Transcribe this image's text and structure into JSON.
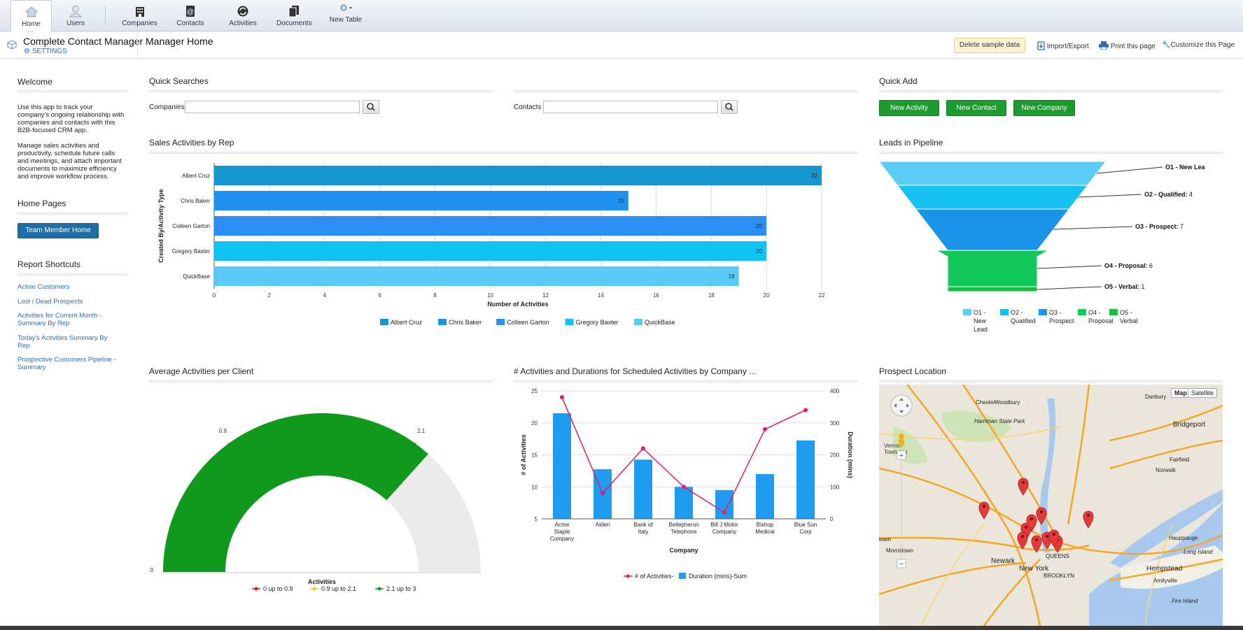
{
  "toolbar": {
    "items": [
      {
        "label": "Home",
        "icon": "home-icon"
      },
      {
        "label": "Users",
        "icon": "user-icon"
      },
      {
        "label": "Companies",
        "icon": "building-icon"
      },
      {
        "label": "Contacts",
        "icon": "contact-card-icon"
      },
      {
        "label": "Activities",
        "icon": "activities-icon"
      },
      {
        "label": "Documents",
        "icon": "documents-icon"
      },
      {
        "label": "New Table",
        "icon": "gear-icon"
      }
    ]
  },
  "header": {
    "app_name": "Complete Contact Manager",
    "settings_label": "SETTINGS",
    "page_name": "Manager Home",
    "delete_label": "Delete sample data",
    "import_label": "Import/Export",
    "print_label": "Print this page",
    "customize_label": "Customize this Page"
  },
  "sidebar": {
    "welcome_title": "Welcome",
    "welcome_p1": [
      "Use this app to track your",
      "company's ongoing relationship with",
      "companies and contacts with this",
      "B2B-focused CRM app."
    ],
    "welcome_p2": [
      "Manage sales activities and",
      "productivity, schedule future calls",
      "and meetings, and attach important",
      "documents to maximize efficiency",
      "and improve workflow process."
    ],
    "home_pages_title": "Home Pages",
    "team_member_button": "Team Member Home",
    "report_shortcuts_title": "Report Shortcuts",
    "links": [
      [
        "Active Customers"
      ],
      [
        "Lost / Dead Prospects"
      ],
      [
        "Activities for Current Month -",
        "Summary By Rep"
      ],
      [
        "Today's Activities Summary By",
        "Rep"
      ],
      [
        "Prospective Customers Pipeline -",
        "Summary"
      ]
    ]
  },
  "quick_searches": {
    "title": "Quick Searches",
    "companies_label": "Companies",
    "companies_value": "",
    "contacts_label": "Contacts",
    "contacts_value": ""
  },
  "quick_add": {
    "title": "Quick Add",
    "buttons": [
      "New Activity",
      "New Contact",
      "New Company"
    ]
  },
  "colors": {
    "bar_series": [
      "#1696cf",
      "#1e90ee",
      "#2a8ef2",
      "#10c3f2",
      "#59c9f8"
    ],
    "funnel": [
      "#5bcdf8",
      "#14c1f0",
      "#1a94e8",
      "#12ca5a",
      "#10c23c"
    ],
    "gauge_green": "#109a1c",
    "gauge_grey": "#ebebeb",
    "line_pink": "#e8196b",
    "column_blue": "#1e9df0"
  },
  "sales_chart": {
    "title": "Sales Activities by Rep",
    "chart_data": {
      "type": "bar",
      "categories": [
        "Albert Cruz",
        "Chris Baker",
        "Colleen Garton",
        "Gregory Baxter",
        "QuickBase"
      ],
      "values": [
        22,
        15,
        20,
        20,
        19
      ],
      "xlabel": "Number of Activities",
      "ylabel": "Created By/Activity Type",
      "xlim": [
        0,
        22
      ],
      "xticks": [
        "0",
        "2",
        "4",
        "6",
        "8",
        "10",
        "12",
        "14",
        "16",
        "18",
        "20",
        "22"
      ],
      "legend": [
        "Albert Cruz",
        "Chris Baker",
        "Colleen Garton",
        "Gregory Baxter",
        "QuickBase"
      ],
      "legend_position": "bottom",
      "grid": true
    }
  },
  "funnel_chart": {
    "title": "Leads in Pipeline",
    "chart_data": {
      "type": "funnel",
      "stages": [
        {
          "name": "O1 - New Lead",
          "value": null,
          "label": "O1 - New Lea"
        },
        {
          "name": "O2 - Qualified",
          "value": 4
        },
        {
          "name": "O3 - Prospect",
          "value": 7
        },
        {
          "name": "O4 - Proposal",
          "value": 6
        },
        {
          "name": "O5 - Verbal",
          "value": 1
        }
      ],
      "legend": [
        [
          "O1 -",
          "New",
          "Lead"
        ],
        [
          "O2 -",
          "Qualified"
        ],
        [
          "O3 -",
          "Prospect"
        ],
        [
          "O4 -",
          "Proposal"
        ],
        [
          "O5 -",
          "Verbal"
        ]
      ],
      "legend_position": "bottom"
    }
  },
  "gauge_chart": {
    "title": "Average Activities per Client",
    "chart_data": {
      "type": "gauge",
      "value": 2.2,
      "min": 0,
      "max": 3,
      "tick_labels": [
        "0",
        "0.9",
        "2.1"
      ],
      "xlabel": "Activities",
      "bands": [
        {
          "name": "0 up to 0.9",
          "color": "#e01b1b"
        },
        {
          "name": "0.9 up to 2.1",
          "color": "#f2c41e"
        },
        {
          "name": "2.1 up to 3",
          "color": "#109a1c"
        }
      ]
    }
  },
  "combo_chart": {
    "title": "# Activities  and Durations for Scheduled Activities by Company ...",
    "chart_data": {
      "type": "bar",
      "categories": [
        [
          "Acme",
          "Staple",
          "Company"
        ],
        [
          "Alden"
        ],
        [
          "Bank of",
          "Italy"
        ],
        [
          "Bellepheron",
          "Telephone"
        ],
        [
          "Bill J Motor",
          "Company"
        ],
        [
          "Bishop",
          "Medical"
        ],
        [
          "Blue Sun",
          "Corp"
        ]
      ],
      "series": [
        {
          "name": "# of Activities-",
          "type": "line",
          "axis": "left",
          "values": [
            24,
            9,
            16,
            10,
            6,
            19,
            22
          ]
        },
        {
          "name": "Duration (mins)-Sum",
          "type": "bar",
          "axis": "right",
          "values": [
            330,
            155,
            185,
            100,
            90,
            140,
            245
          ]
        }
      ],
      "xlabel": "Company",
      "ylabel": "# of Activities",
      "y2label": "Duration (mins)",
      "ylim": [
        5,
        25
      ],
      "y2lim": [
        0,
        400
      ],
      "yticks": [
        "25",
        "20",
        "15",
        "10",
        "5"
      ],
      "y2ticks": [
        "400",
        "300",
        "200",
        "100",
        "0"
      ],
      "legend_position": "bottom",
      "grid": true
    }
  },
  "map": {
    "title": "Prospect Location",
    "map_label": "Map",
    "satellite_label": "Satellite",
    "places": [
      {
        "name": "Danbury"
      },
      {
        "name": "Chester"
      },
      {
        "name": "Woodbury"
      },
      {
        "name": "Harriman State Park"
      },
      {
        "name": "Bridgeport"
      },
      {
        "name": "Fairfield"
      },
      {
        "name": "Norwalk"
      },
      {
        "name": "Vernon Township"
      },
      {
        "name": "Morristown"
      },
      {
        "name": "Newark"
      },
      {
        "name": "New York"
      },
      {
        "name": "Hauppauge"
      },
      {
        "name": "Long Island"
      },
      {
        "name": "Hempstead"
      },
      {
        "name": "Amityville"
      },
      {
        "name": "Fire Island"
      },
      {
        "name": "QUEENS"
      },
      {
        "name": "BROOKLYN"
      },
      {
        "name": "town"
      }
    ],
    "marker_count": 11
  }
}
